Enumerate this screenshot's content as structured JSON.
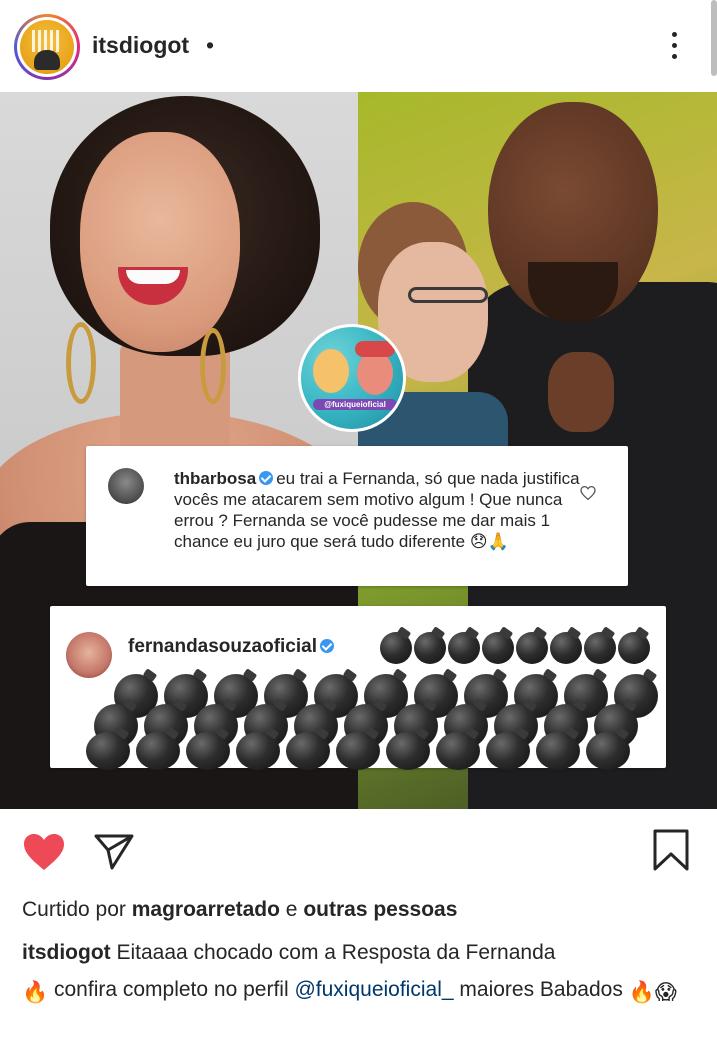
{
  "header": {
    "username": "itsdiogot",
    "separator": "•"
  },
  "post": {
    "watermark_text": "@fuxiqueioficial",
    "comment1": {
      "username": "thbarbosa",
      "text": "eu trai a Fernanda, só que nada justifica vocês me atacarem sem motivo algum ! Que nunca errou ? Fernanda se você pudesse me dar mais 1 chance eu juro que será tudo diferente 😞🙏"
    },
    "comment2": {
      "username": "fernandasouzaoficial",
      "emoji_count_shown": "bombs"
    }
  },
  "actions": {
    "like_icon": "heart-icon",
    "share_icon": "send-icon",
    "save_icon": "bookmark-icon",
    "liked_color": "#ed4956"
  },
  "likes": {
    "prefix": "Curtido por",
    "user": "magroarretado",
    "connector": "e",
    "others": "outras pessoas"
  },
  "caption": {
    "username": "itsdiogot",
    "text_part1": "Eitaaaa chocado com a Resposta da Fernanda",
    "emoji1": "🔥",
    "text_part2": "confira completo no perfil",
    "mention": "@fuxiqueioficial_",
    "text_part3": "maiores Babados",
    "emoji2": "🔥😱"
  }
}
